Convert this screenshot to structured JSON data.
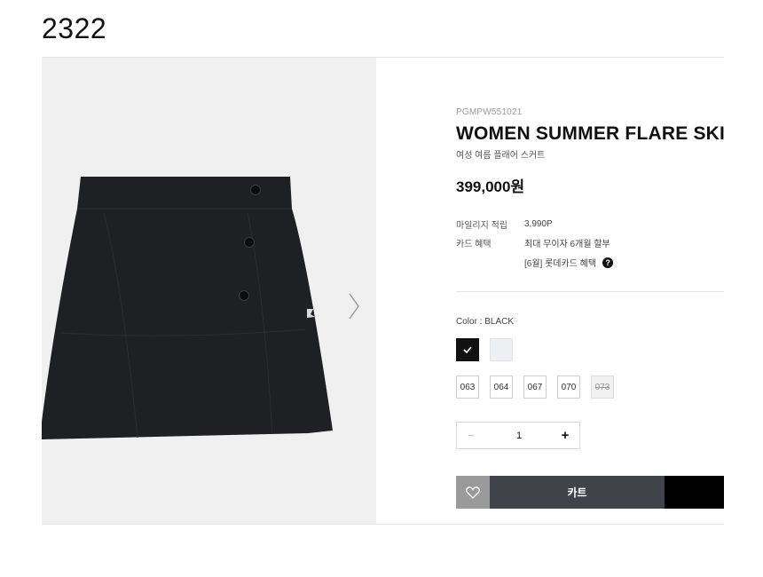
{
  "page_label": "2322",
  "product": {
    "code": "PGMPW551021",
    "title": "WOMEN SUMMER FLARE SKI",
    "subtitle": "여성 여름 플래어 스커트",
    "price": "399,000원"
  },
  "benefits": [
    {
      "label": "마일리지 적립",
      "value": "3,990P"
    },
    {
      "label": "카드 혜택",
      "value": "최대 무이자 6개월 할부"
    },
    {
      "label": "",
      "value": "[6월] 롯데카드 혜택"
    }
  ],
  "info_badge": "?",
  "color": {
    "label": "Color : BLACK",
    "swatches": [
      {
        "name": "black",
        "hex": "#111111",
        "selected": true
      },
      {
        "name": "light-gray",
        "hex": "#eeeff2",
        "selected": false
      }
    ]
  },
  "sizes": [
    {
      "label": "063",
      "sold_out": false
    },
    {
      "label": "064",
      "sold_out": false
    },
    {
      "label": "067",
      "sold_out": false
    },
    {
      "label": "070",
      "sold_out": false
    },
    {
      "label": "073",
      "sold_out": true
    }
  ],
  "quantity": {
    "minus": "−",
    "value": "1",
    "plus": "+"
  },
  "actions": {
    "cart_label": "카트",
    "buy_label": ""
  },
  "icons": {
    "next": "chevron-right-icon",
    "wish": "heart-icon",
    "check": "check-icon"
  },
  "colors": {
    "cart_bg": "#40444a",
    "wish_bg": "#9a9a9a",
    "gallery_bg": "#f0f0f0"
  }
}
